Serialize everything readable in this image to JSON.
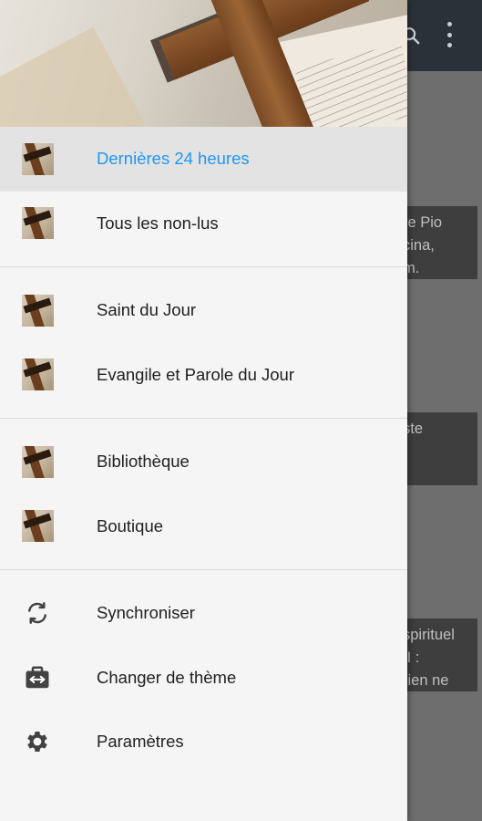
{
  "drawer": {
    "groups": [
      [
        {
          "label": "Dernières 24 heures",
          "icon": "category-thumbnail-icon",
          "active": true
        },
        {
          "label": "Tous les non-lus",
          "icon": "category-thumbnail-icon",
          "active": false
        }
      ],
      [
        {
          "label": "Saint du Jour",
          "icon": "category-thumbnail-icon",
          "active": false
        },
        {
          "label": "Evangile et Parole du Jour",
          "icon": "category-thumbnail-icon",
          "active": false
        }
      ],
      [
        {
          "label": "Bibliothèque",
          "icon": "category-thumbnail-icon",
          "active": false
        },
        {
          "label": "Boutique",
          "icon": "category-thumbnail-icon",
          "active": false
        }
      ],
      [
        {
          "label": "Synchroniser",
          "icon": "sync-icon",
          "active": false
        },
        {
          "label": "Changer de thème",
          "icon": "theme-switch-icon",
          "active": false
        },
        {
          "label": "Paramètres",
          "icon": "gear-icon",
          "active": false
        }
      ]
    ]
  },
  "background": {
    "card1": "re Pio\ncina,\nm.",
    "card2": "ste",
    "card3": "spirituel\nII :\nrien ne"
  },
  "colors": {
    "accent": "#2196f3",
    "drawer_bg": "#f5f5f5",
    "active_bg": "#e3e3e3",
    "toolbar": "#2b3138"
  }
}
